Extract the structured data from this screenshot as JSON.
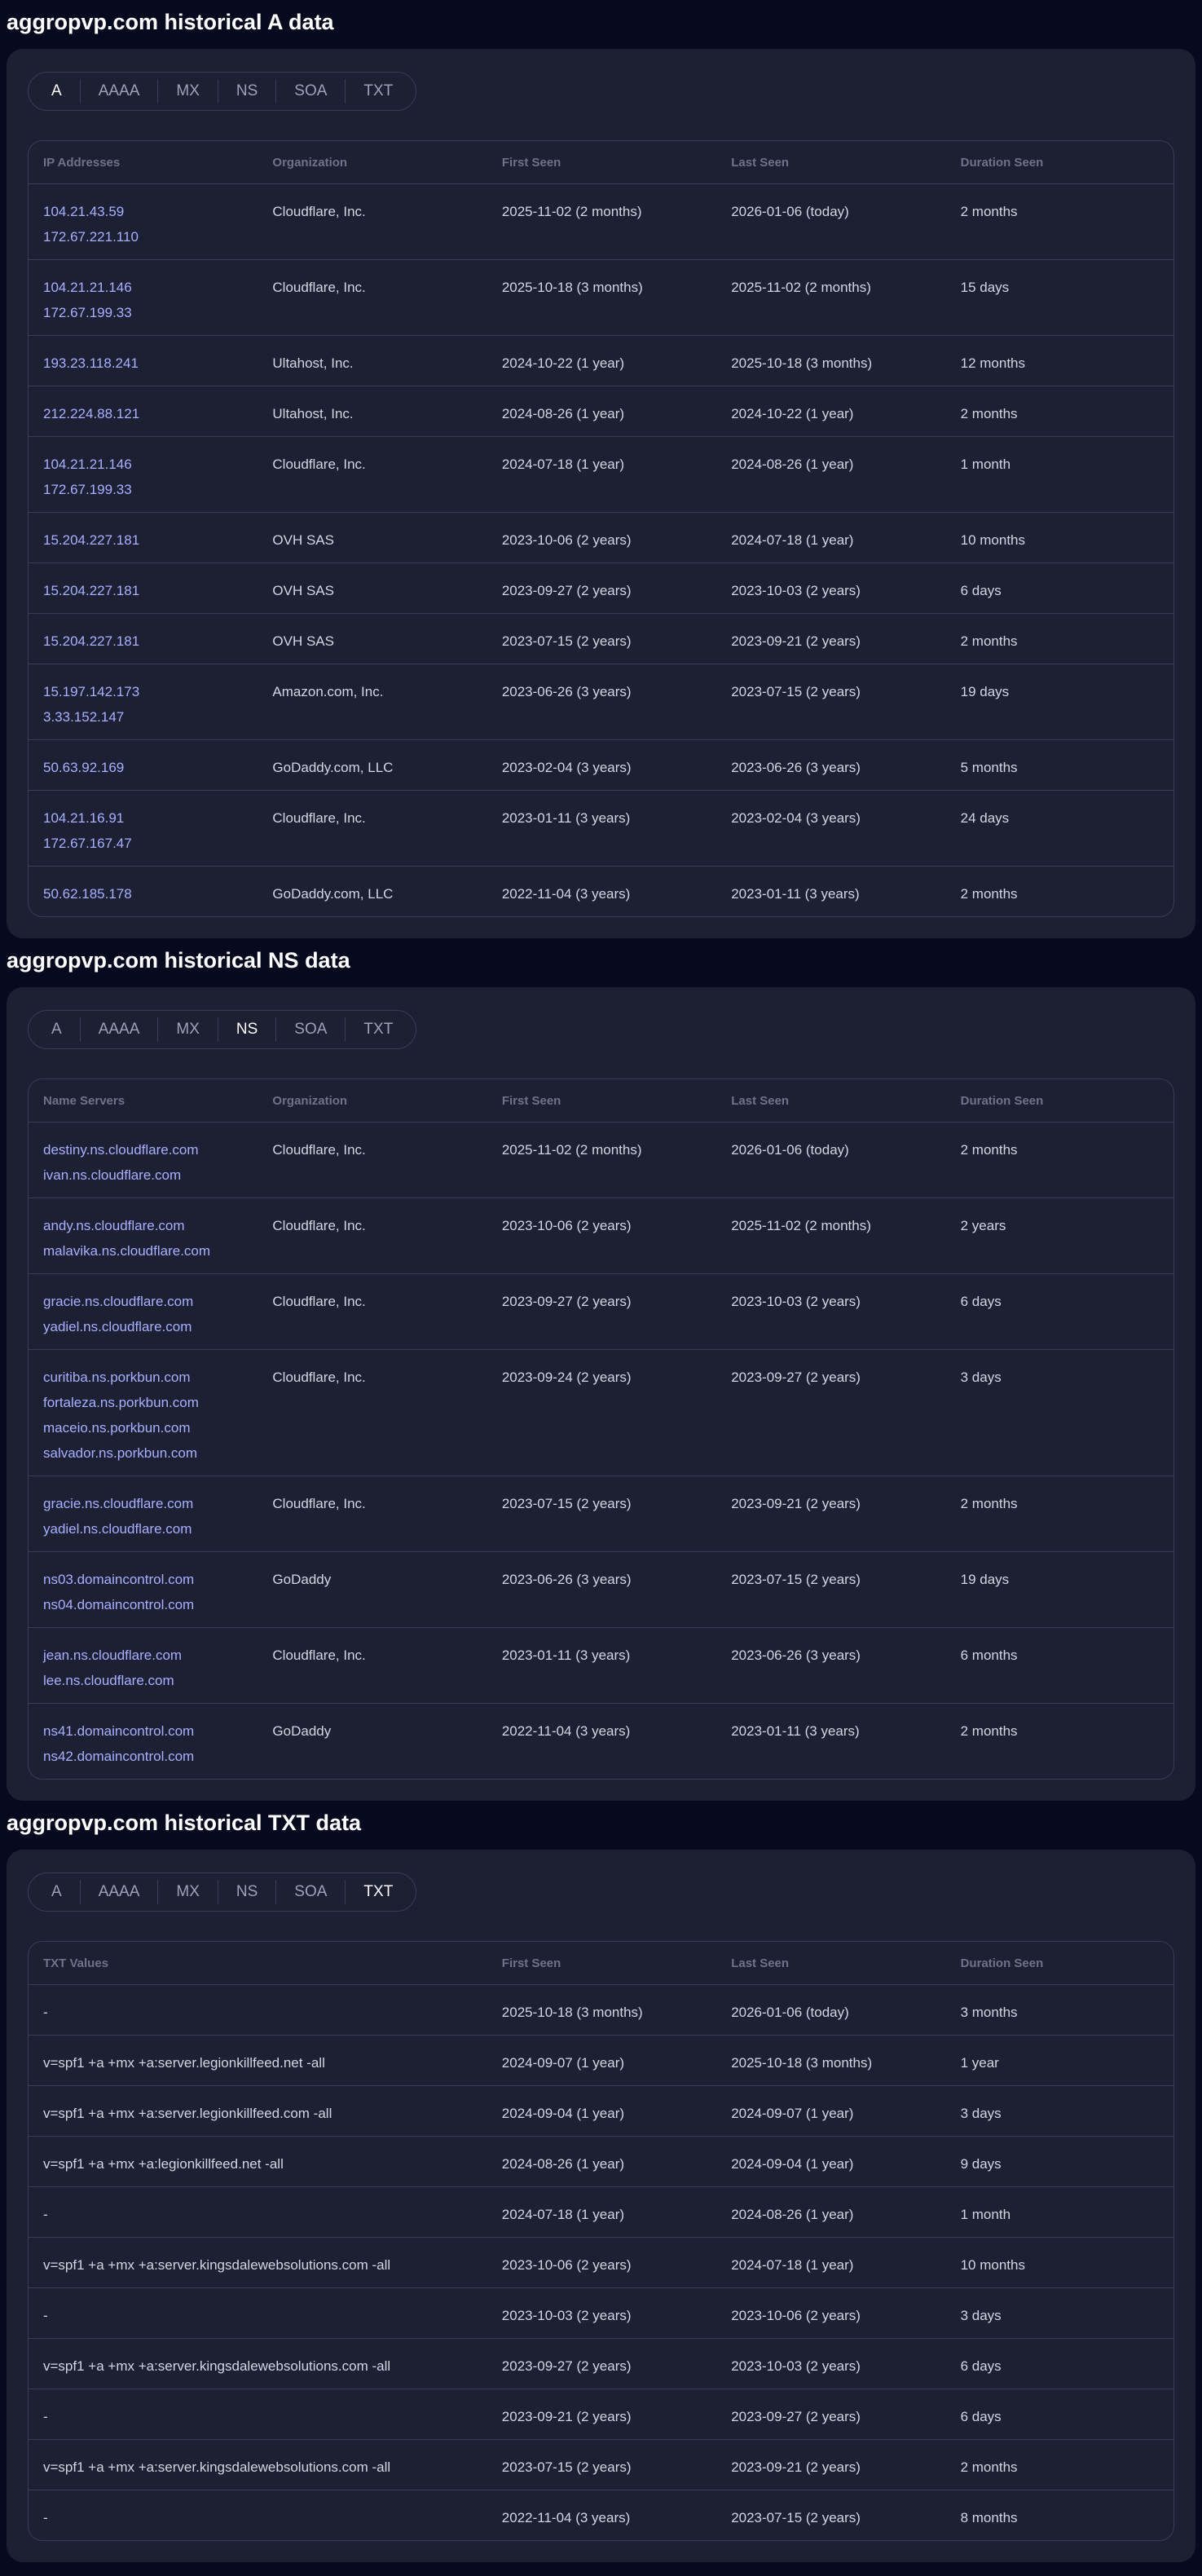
{
  "sections": [
    {
      "title": "aggropvp.com historical A data",
      "active_tab": "A",
      "tabs": [
        "A",
        "AAAA",
        "MX",
        "NS",
        "SOA",
        "TXT"
      ],
      "headers": [
        "IP Addresses",
        "Organization",
        "First Seen",
        "Last Seen",
        "Duration Seen"
      ],
      "rows": [
        {
          "values": [
            "104.21.43.59",
            "172.67.221.110"
          ],
          "org": "Cloudflare, Inc.",
          "first": "2025-11-02 (2 months)",
          "last": "2026-01-06 (today)",
          "duration": "2 months"
        },
        {
          "values": [
            "104.21.21.146",
            "172.67.199.33"
          ],
          "org": "Cloudflare, Inc.",
          "first": "2025-10-18 (3 months)",
          "last": "2025-11-02 (2 months)",
          "duration": "15 days"
        },
        {
          "values": [
            "193.23.118.241"
          ],
          "org": "Ultahost, Inc.",
          "first": "2024-10-22 (1 year)",
          "last": "2025-10-18 (3 months)",
          "duration": "12 months"
        },
        {
          "values": [
            "212.224.88.121"
          ],
          "org": "Ultahost, Inc.",
          "first": "2024-08-26 (1 year)",
          "last": "2024-10-22 (1 year)",
          "duration": "2 months"
        },
        {
          "values": [
            "104.21.21.146",
            "172.67.199.33"
          ],
          "org": "Cloudflare, Inc.",
          "first": "2024-07-18 (1 year)",
          "last": "2024-08-26 (1 year)",
          "duration": "1 month"
        },
        {
          "values": [
            "15.204.227.181"
          ],
          "org": "OVH SAS",
          "first": "2023-10-06 (2 years)",
          "last": "2024-07-18 (1 year)",
          "duration": "10 months"
        },
        {
          "values": [
            "15.204.227.181"
          ],
          "org": "OVH SAS",
          "first": "2023-09-27 (2 years)",
          "last": "2023-10-03 (2 years)",
          "duration": "6 days"
        },
        {
          "values": [
            "15.204.227.181"
          ],
          "org": "OVH SAS",
          "first": "2023-07-15 (2 years)",
          "last": "2023-09-21 (2 years)",
          "duration": "2 months"
        },
        {
          "values": [
            "15.197.142.173",
            "3.33.152.147"
          ],
          "org": "Amazon.com, Inc.",
          "first": "2023-06-26 (3 years)",
          "last": "2023-07-15 (2 years)",
          "duration": "19 days"
        },
        {
          "values": [
            "50.63.92.169"
          ],
          "org": "GoDaddy.com, LLC",
          "first": "2023-02-04 (3 years)",
          "last": "2023-06-26 (3 years)",
          "duration": "5 months"
        },
        {
          "values": [
            "104.21.16.91",
            "172.67.167.47"
          ],
          "org": "Cloudflare, Inc.",
          "first": "2023-01-11 (3 years)",
          "last": "2023-02-04 (3 years)",
          "duration": "24 days"
        },
        {
          "values": [
            "50.62.185.178"
          ],
          "org": "GoDaddy.com, LLC",
          "first": "2022-11-04 (3 years)",
          "last": "2023-01-11 (3 years)",
          "duration": "2 months"
        }
      ]
    },
    {
      "title": "aggropvp.com historical NS data",
      "active_tab": "NS",
      "tabs": [
        "A",
        "AAAA",
        "MX",
        "NS",
        "SOA",
        "TXT"
      ],
      "headers": [
        "Name Servers",
        "Organization",
        "First Seen",
        "Last Seen",
        "Duration Seen"
      ],
      "rows": [
        {
          "values": [
            "destiny.ns.cloudflare.com",
            "ivan.ns.cloudflare.com"
          ],
          "org": "Cloudflare, Inc.",
          "first": "2025-11-02 (2 months)",
          "last": "2026-01-06 (today)",
          "duration": "2 months"
        },
        {
          "values": [
            "andy.ns.cloudflare.com",
            "malavika.ns.cloudflare.com"
          ],
          "org": "Cloudflare, Inc.",
          "first": "2023-10-06 (2 years)",
          "last": "2025-11-02 (2 months)",
          "duration": "2 years"
        },
        {
          "values": [
            "gracie.ns.cloudflare.com",
            "yadiel.ns.cloudflare.com"
          ],
          "org": "Cloudflare, Inc.",
          "first": "2023-09-27 (2 years)",
          "last": "2023-10-03 (2 years)",
          "duration": "6 days"
        },
        {
          "values": [
            "curitiba.ns.porkbun.com",
            "fortaleza.ns.porkbun.com",
            "maceio.ns.porkbun.com",
            "salvador.ns.porkbun.com"
          ],
          "org": "Cloudflare, Inc.",
          "first": "2023-09-24 (2 years)",
          "last": "2023-09-27 (2 years)",
          "duration": "3 days"
        },
        {
          "values": [
            "gracie.ns.cloudflare.com",
            "yadiel.ns.cloudflare.com"
          ],
          "org": "Cloudflare, Inc.",
          "first": "2023-07-15 (2 years)",
          "last": "2023-09-21 (2 years)",
          "duration": "2 months"
        },
        {
          "values": [
            "ns03.domaincontrol.com",
            "ns04.domaincontrol.com"
          ],
          "org": "GoDaddy",
          "first": "2023-06-26 (3 years)",
          "last": "2023-07-15 (2 years)",
          "duration": "19 days"
        },
        {
          "values": [
            "jean.ns.cloudflare.com",
            "lee.ns.cloudflare.com"
          ],
          "org": "Cloudflare, Inc.",
          "first": "2023-01-11 (3 years)",
          "last": "2023-06-26 (3 years)",
          "duration": "6 months"
        },
        {
          "values": [
            "ns41.domaincontrol.com",
            "ns42.domaincontrol.com"
          ],
          "org": "GoDaddy",
          "first": "2022-11-04 (3 years)",
          "last": "2023-01-11 (3 years)",
          "duration": "2 months"
        }
      ]
    },
    {
      "title": "aggropvp.com historical TXT data",
      "active_tab": "TXT",
      "tabs": [
        "A",
        "AAAA",
        "MX",
        "NS",
        "SOA",
        "TXT"
      ],
      "headers": [
        "TXT Values",
        "First Seen",
        "Last Seen",
        "Duration Seen"
      ],
      "rows": [
        {
          "values": [
            "-"
          ],
          "first": "2025-10-18 (3 months)",
          "last": "2026-01-06 (today)",
          "duration": "3 months"
        },
        {
          "values": [
            "v=spf1 +a +mx +a:server.legionkillfeed.net -all"
          ],
          "first": "2024-09-07 (1 year)",
          "last": "2025-10-18 (3 months)",
          "duration": "1 year"
        },
        {
          "values": [
            "v=spf1 +a +mx +a:server.legionkillfeed.com -all"
          ],
          "first": "2024-09-04 (1 year)",
          "last": "2024-09-07 (1 year)",
          "duration": "3 days"
        },
        {
          "values": [
            "v=spf1 +a +mx +a:legionkillfeed.net -all"
          ],
          "first": "2024-08-26 (1 year)",
          "last": "2024-09-04 (1 year)",
          "duration": "9 days"
        },
        {
          "values": [
            "-"
          ],
          "first": "2024-07-18 (1 year)",
          "last": "2024-08-26 (1 year)",
          "duration": "1 month"
        },
        {
          "values": [
            "v=spf1 +a +mx +a:server.kingsdalewebsolutions.com -all"
          ],
          "first": "2023-10-06 (2 years)",
          "last": "2024-07-18 (1 year)",
          "duration": "10 months"
        },
        {
          "values": [
            "-"
          ],
          "first": "2023-10-03 (2 years)",
          "last": "2023-10-06 (2 years)",
          "duration": "3 days"
        },
        {
          "values": [
            "v=spf1 +a +mx +a:server.kingsdalewebsolutions.com -all"
          ],
          "first": "2023-09-27 (2 years)",
          "last": "2023-10-03 (2 years)",
          "duration": "6 days"
        },
        {
          "values": [
            "-"
          ],
          "first": "2023-09-21 (2 years)",
          "last": "2023-09-27 (2 years)",
          "duration": "6 days"
        },
        {
          "values": [
            "v=spf1 +a +mx +a:server.kingsdalewebsolutions.com -all"
          ],
          "first": "2023-07-15 (2 years)",
          "last": "2023-09-21 (2 years)",
          "duration": "2 months"
        },
        {
          "values": [
            "-"
          ],
          "first": "2022-11-04 (3 years)",
          "last": "2023-07-15 (2 years)",
          "duration": "8 months"
        }
      ]
    }
  ],
  "colors": {
    "page_bg": "#070a1f",
    "card_bg": "#1d1f33",
    "border": "#393c55",
    "link": "#a7b0ff",
    "text": "#d3d6e2",
    "muted": "#6f7389"
  }
}
